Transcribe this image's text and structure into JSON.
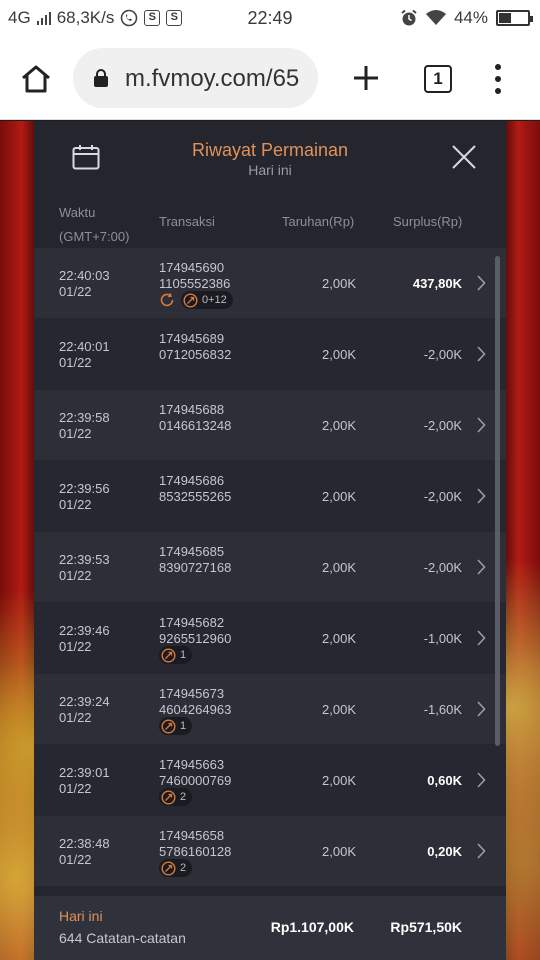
{
  "status_bar": {
    "network": "4G",
    "speed": "68,3K/s",
    "time": "22:49",
    "battery": "44%",
    "battery_level": 0.44
  },
  "browser": {
    "url": "m.fvmoy.com/65",
    "tab_count": "1"
  },
  "modal": {
    "title": "Riwayat Permainan",
    "subtitle": "Hari ini",
    "columns": {
      "time": "Waktu",
      "timezone": "(GMT+7:00)",
      "transaction": "Transaksi",
      "bet": "Taruhan(Rp)",
      "surplus": "Surplus(Rp)"
    },
    "rows": [
      {
        "time": "22:40:03",
        "date": "01/22",
        "id1": "174945690",
        "id2": "1105552386",
        "bet": "2,00K",
        "surplus": "437,80K",
        "positive": true,
        "refresh": true,
        "badge": "0+12"
      },
      {
        "time": "22:40:01",
        "date": "01/22",
        "id1": "174945689",
        "id2": "0712056832",
        "bet": "2,00K",
        "surplus": "-2,00K",
        "positive": false
      },
      {
        "time": "22:39:58",
        "date": "01/22",
        "id1": "174945688",
        "id2": "0146613248",
        "bet": "2,00K",
        "surplus": "-2,00K",
        "positive": false
      },
      {
        "time": "22:39:56",
        "date": "01/22",
        "id1": "174945686",
        "id2": "8532555265",
        "bet": "2,00K",
        "surplus": "-2,00K",
        "positive": false
      },
      {
        "time": "22:39:53",
        "date": "01/22",
        "id1": "174945685",
        "id2": "8390727168",
        "bet": "2,00K",
        "surplus": "-2,00K",
        "positive": false
      },
      {
        "time": "22:39:46",
        "date": "01/22",
        "id1": "174945682",
        "id2": "9265512960",
        "bet": "2,00K",
        "surplus": "-1,00K",
        "positive": false,
        "badge": "1"
      },
      {
        "time": "22:39:24",
        "date": "01/22",
        "id1": "174945673",
        "id2": "4604264963",
        "bet": "2,00K",
        "surplus": "-1,60K",
        "positive": false,
        "badge": "1"
      },
      {
        "time": "22:39:01",
        "date": "01/22",
        "id1": "174945663",
        "id2": "7460000769",
        "bet": "2,00K",
        "surplus": "0,60K",
        "positive": true,
        "badge": "2"
      },
      {
        "time": "22:38:48",
        "date": "01/22",
        "id1": "174945658",
        "id2": "5786160128",
        "bet": "2,00K",
        "surplus": "0,20K",
        "positive": true,
        "badge": "2"
      }
    ],
    "footer": {
      "label": "Hari ini",
      "count": "644 Catatan-catatan",
      "total_bet": "Rp1.107,00K",
      "total_surplus": "Rp571,50K"
    }
  },
  "colors": {
    "accent": "#e0925a",
    "modal_bg": "#24252d"
  }
}
